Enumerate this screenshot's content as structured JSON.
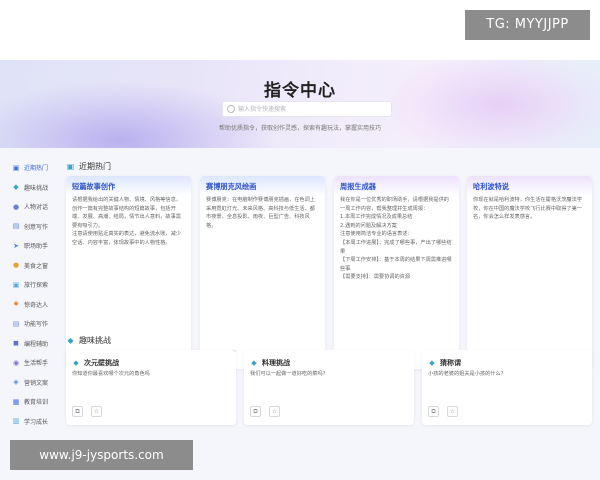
{
  "watermarks": {
    "top": "TG: MYYJJPP",
    "bottom": "www.j9-jysports.com"
  },
  "hero": {
    "title": "指令中心",
    "search_placeholder": "输入指令快速搜索",
    "subtitle": "帮助优质指令，获取创作灵感，探索有趣玩法，掌握实用技巧"
  },
  "sidebar": {
    "items": [
      {
        "label": "近期热门",
        "icon": "fire-icon",
        "active": true
      },
      {
        "label": "趣味挑战",
        "icon": "gem-icon"
      },
      {
        "label": "人物对话",
        "icon": "user-icon"
      },
      {
        "label": "创意写作",
        "icon": "pen-icon"
      },
      {
        "label": "职场助手",
        "icon": "send-icon"
      },
      {
        "label": "美食之窗",
        "icon": "food-icon"
      },
      {
        "label": "旅行探索",
        "icon": "travel-icon"
      },
      {
        "label": "惊奇达人",
        "icon": "star-icon"
      },
      {
        "label": "功能写作",
        "icon": "doc-icon"
      },
      {
        "label": "编程辅助",
        "icon": "code-icon"
      },
      {
        "label": "生活帮手",
        "icon": "life-icon"
      },
      {
        "label": "营销文案",
        "icon": "megaphone-icon"
      },
      {
        "label": "教育培训",
        "icon": "book-icon"
      },
      {
        "label": "学习成长",
        "icon": "grow-icon"
      }
    ]
  },
  "sections": {
    "hot": {
      "title": "近期热门",
      "cards": [
        {
          "title": "短篇故事创作",
          "body": "请根据我给出的关键人物、情境、风格等信息，创作一篇有完整故事结构的短篇故事，包括开端、发展、高潮、结局，情节出人意料，故事需要有吸引力。\n注意请使用贴近真实的表达，避免流水账，减少空话、内容丰富，体现故事中的人物性格。"
        },
        {
          "title": "赛博朋克风绘画",
          "body": "赛博朋克：在电脑制作赛博朋克插画，在色调上采用霓虹灯光、未来风格、高科技与低生活、都市夜景、全息投影、雨夜、巨型广告、科技风格。"
        },
        {
          "title": "周报生成器",
          "body": "我在你是一位优秀的职场助手，请根据我提供的一周工作内容，帮我整理并生成周报：\n1.本周工作完成情况及成果总结\n2.遇到的问题及解决方案\n注意使用简洁专业的语言表述：\n【本周工作进展】：完成了哪些事，产出了哪些结果\n【下周工作安排】：基于本周的结果下周需推进哪些事\n【需要支持】：需要协调的资源"
        },
        {
          "title": "哈利波特说",
          "body": "你现在就是哈利波特，你生活在霍格沃茨魔法学校，你在中国的魔法学校飞行比赛中取得了第一名，你会怎么样发表感言。"
        }
      ]
    },
    "fun": {
      "title": "趣味挑战",
      "cards": [
        {
          "title": "次元壁挑战",
          "body": "你知道你最喜欢哪个次元的角色吗"
        },
        {
          "title": "料理挑战",
          "body": "我们可以一起做一道好吃的菜吗？"
        },
        {
          "title": "猜称谓",
          "body": "小孩的老婆的姐夫是小孩的什么？"
        }
      ]
    }
  }
}
